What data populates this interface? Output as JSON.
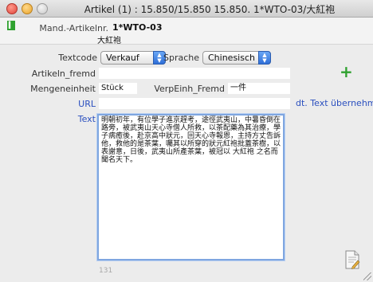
{
  "window": {
    "title": "Artikel (1) : 15.850/15.850 15.850.  1*WTO-03/大紅袍"
  },
  "header": {
    "mand_label": "Mand.-Artikelnr.",
    "mand_value": "1*WTO-03",
    "mand_sub": "大紅袍",
    "marker_color": "#2fa12f"
  },
  "form": {
    "textcode_label": "Textcode",
    "textcode_value": "Verkauf",
    "sprache_label": "Sprache",
    "sprache_value": "Chinesisch",
    "artikeln_fremd_label": "Artikeln_fremd",
    "artikeln_fremd_value": "",
    "mengeneinheit_label": "Mengeneinheit",
    "mengeneinheit_value": "Stück",
    "verpeinh_label": "VerpEinh_Fremd",
    "verpeinh_value": "一件",
    "url_label": "URL",
    "url_value": "",
    "dt_text_link": "dt. Text übernehmen",
    "text_label": "Text",
    "text_value": "明朝初年，有位學子進京趕考，途徑武夷山，中暑昏倒在路旁，被武夷山天心寺僧人所救，以茶配藥為其治療，學子病癒後，赴京高中狀元，回天心寺報恩，主持方丈告訴他，救他的是茶葉，囑其以所穿的狀元紅袍批蓋茶樹，以表謝意，日後，武夷山所產茶葉，被冠以 大紅袍 之名而聞名天下。",
    "char_count": "131"
  },
  "icons": {
    "add": "plus-icon",
    "document": "document-edit-icon",
    "accent": "#2a4fbf"
  }
}
